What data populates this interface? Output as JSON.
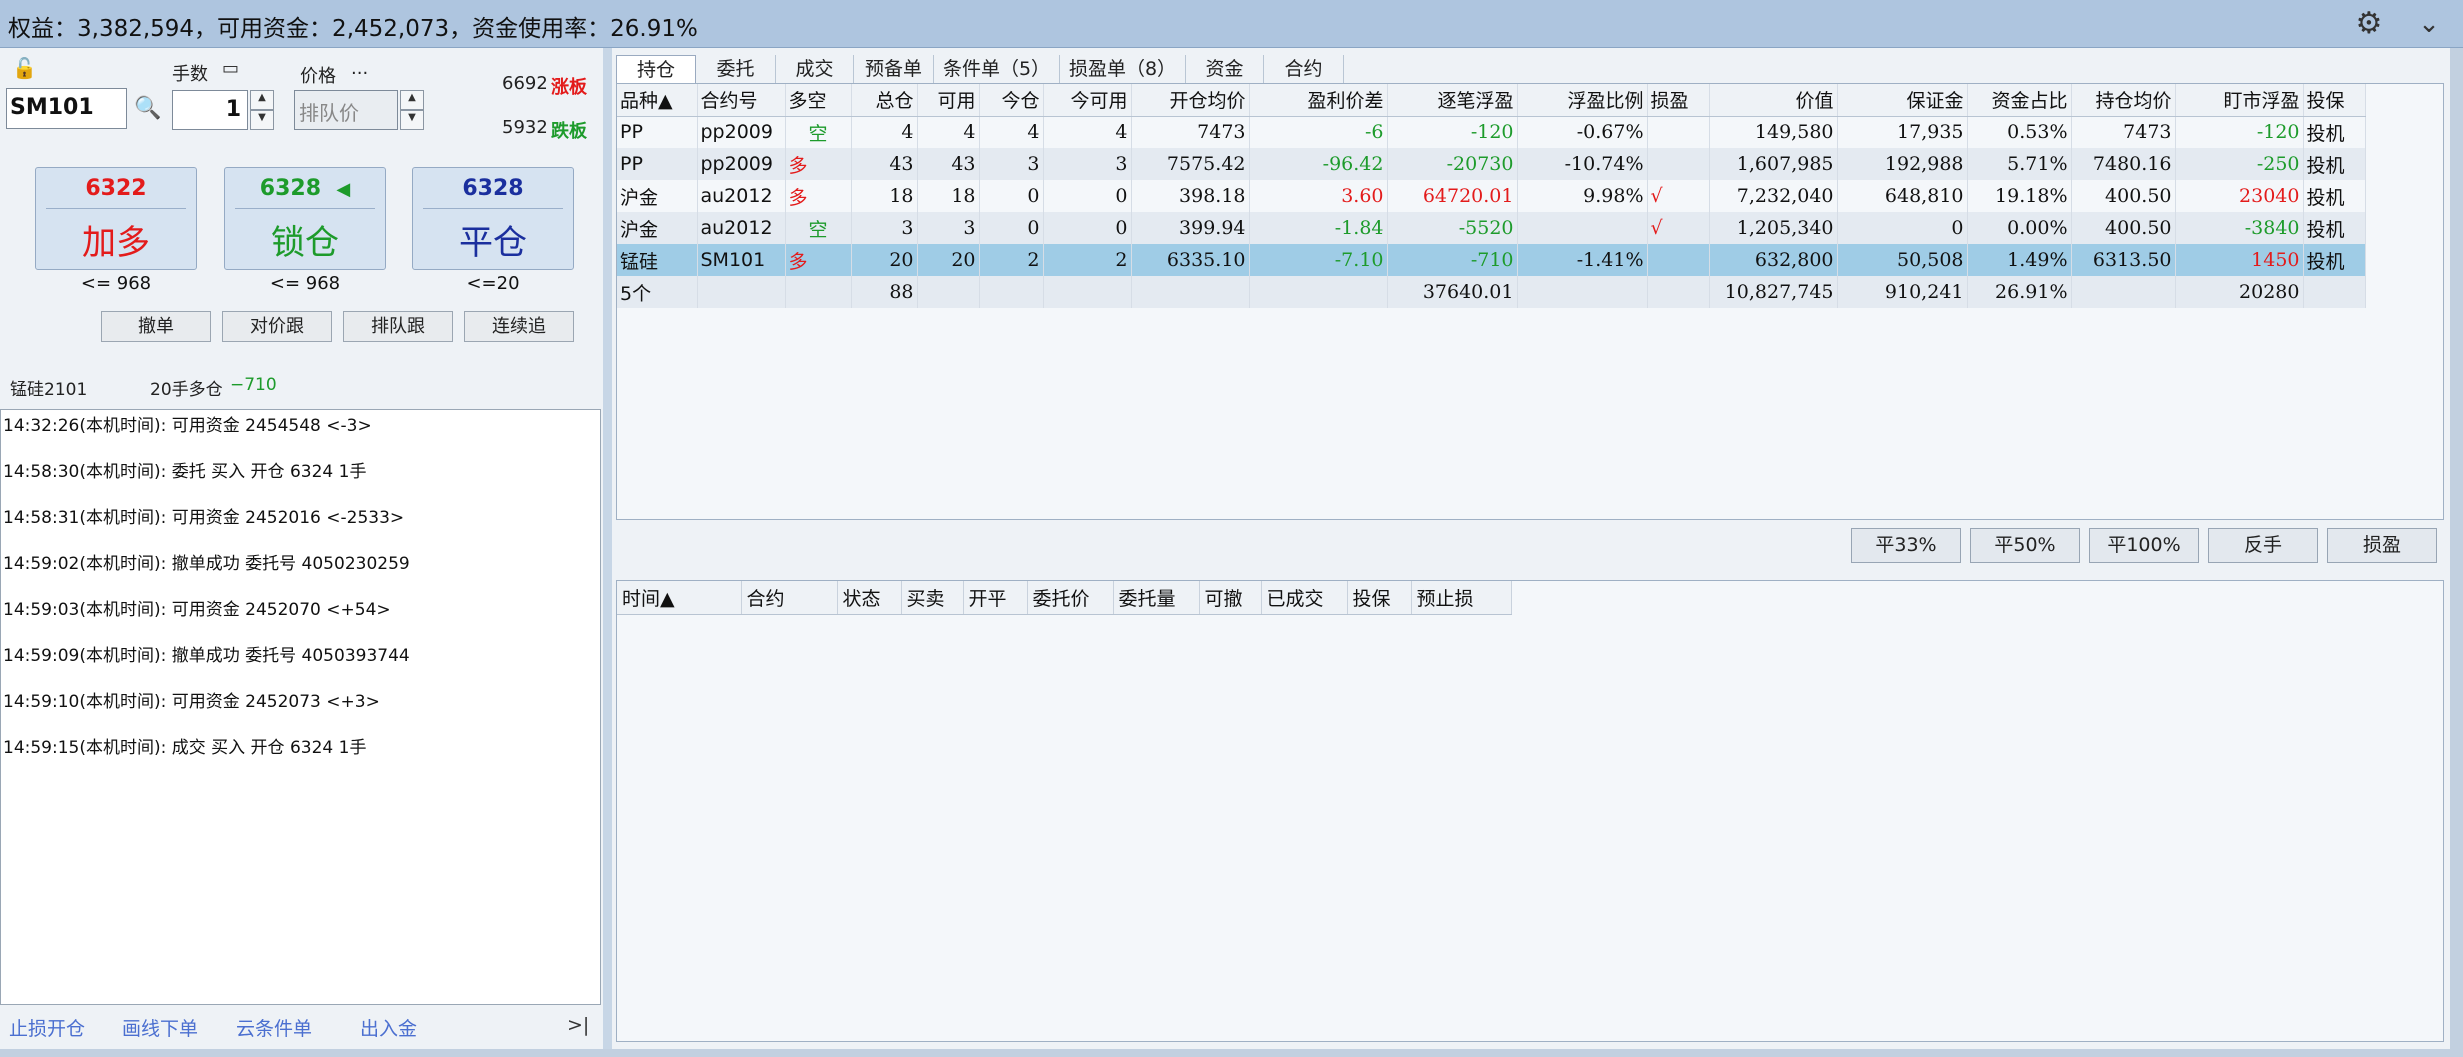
{
  "topbar": {
    "summary": "权益：3,382,594，可用资金：2,452,073，资金使用率：26.91%"
  },
  "left": {
    "qty_label": "手数",
    "price_label": "价格",
    "price_more": "...",
    "symbol_value": "SM101",
    "qty_value": "1",
    "price_placeholder": "排队价",
    "limit_up_price": "6692",
    "limit_up_label": "涨板",
    "limit_down_price": "5932",
    "limit_down_label": "跌板",
    "buttons": [
      {
        "price": "6322",
        "name": "加多",
        "color": "#e31b1b",
        "under": "<= 968"
      },
      {
        "price": "6328",
        "name": "锁仓",
        "color": "#1d9b2b",
        "under": "<= 968",
        "marker": "◀"
      },
      {
        "price": "6328",
        "name": "平仓",
        "color": "#1b2f9e",
        "under": "<=20"
      }
    ],
    "small_buttons": [
      "撤单",
      "对价跟",
      "排队跟",
      "连续追"
    ],
    "position_line": {
      "contract": "锰硅2101",
      "desc": "20手多仓",
      "pnl": "−710"
    },
    "log": [
      "14:32:26(本机时间): 可用资金 2454548  <-3>",
      "14:58:30(本机时间): 委托  买入  开仓  6324  1手",
      "14:58:31(本机时间): 可用资金 2452016  <-2533>",
      "14:59:02(本机时间): 撤单成功  委托号  4050230259",
      "14:59:03(本机时间): 可用资金 2452070  <+54>",
      "14:59:09(本机时间): 撤单成功  委托号  4050393744",
      "14:59:10(本机时间): 可用资金 2452073  <+3>",
      "14:59:15(本机时间): 成交  买入  开仓  6324  1手"
    ],
    "bottom_links": [
      "止损开仓",
      "画线下单",
      "云条件单",
      "出入金"
    ],
    "collapse_glyph": ">|"
  },
  "tabs": [
    "持仓",
    "委托",
    "成交",
    "预备单",
    "条件单（5）",
    "损盈单（8）",
    "资金",
    "合约"
  ],
  "positions": {
    "headers": [
      "品种▲",
      "合约号",
      "多空",
      "总仓",
      "可用",
      "今仓",
      "今可用",
      "开仓均价",
      "盈利价差",
      "逐笔浮盈",
      "浮盈比例",
      "损盈",
      "价值",
      "保证金",
      "资金占比",
      "持仓均价",
      "盯市浮盈",
      "投保"
    ],
    "rows": [
      {
        "v": [
          "PP",
          "pp2009",
          "空",
          "4",
          "4",
          "4",
          "4",
          "7473",
          "-6",
          "-120",
          "-0.67%",
          "",
          "149,580",
          "17,935",
          "0.53%",
          "7473",
          "-120",
          "投机"
        ],
        "dir": "green",
        "pnl": "green",
        "mkt": "green",
        "style": "rowa"
      },
      {
        "v": [
          "PP",
          "pp2009",
          "多",
          "43",
          "43",
          "3",
          "3",
          "7575.42",
          "-96.42",
          "-20730",
          "-10.74%",
          "",
          "1,607,985",
          "192,988",
          "5.71%",
          "7480.16",
          "-250",
          "投机"
        ],
        "dir": "red",
        "pnl": "green",
        "mkt": "green",
        "style": "rowb"
      },
      {
        "v": [
          "沪金",
          "au2012",
          "多",
          "18",
          "18",
          "0",
          "0",
          "398.18",
          "3.60",
          "64720.01",
          "9.98%",
          "√",
          "7,232,040",
          "648,810",
          "19.18%",
          "400.50",
          "23040",
          "投机"
        ],
        "dir": "red",
        "pnl": "red",
        "mkt": "red",
        "style": "rowa"
      },
      {
        "v": [
          "沪金",
          "au2012",
          "空",
          "3",
          "3",
          "0",
          "0",
          "399.94",
          "-1.84",
          "-5520",
          "",
          "√",
          "1,205,340",
          "0",
          "0.00%",
          "400.50",
          "-3840",
          "投机"
        ],
        "dir": "green",
        "pnl": "green",
        "mkt": "green",
        "style": "rowb"
      },
      {
        "v": [
          "锰硅",
          "SM101",
          "多",
          "20",
          "20",
          "2",
          "2",
          "6335.10",
          "-7.10",
          "-710",
          "-1.41%",
          "",
          "632,800",
          "50,508",
          "1.49%",
          "6313.50",
          "1450",
          "投机"
        ],
        "dir": "red",
        "pnl": "green",
        "mkt": "red",
        "style": "sel"
      }
    ],
    "total": [
      "5个",
      "",
      "",
      "88",
      "",
      "",
      "",
      "",
      "",
      "37640.01",
      "",
      "",
      "10,827,745",
      "910,241",
      "26.91%",
      "",
      "20280",
      ""
    ]
  },
  "action_buttons": [
    "平33%",
    "平50%",
    "平100%",
    "反手",
    "损盈"
  ],
  "orders": {
    "headers": [
      "时间▲",
      "合约",
      "状态",
      "买卖",
      "开平",
      "委托价",
      "委托量",
      "可撤",
      "已成交",
      "投保",
      "预止损"
    ]
  },
  "colors": {
    "red": "#e31b1b",
    "green": "#1d9b2b",
    "blue": "#1b2f9e",
    "selected_row": "#9fcce6"
  }
}
